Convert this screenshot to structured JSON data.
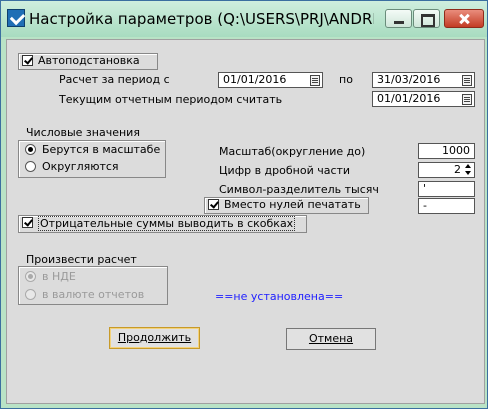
{
  "window": {
    "title": "Настройка параметров (Q:\\USERS\\PRJ\\ANDREYV..."
  },
  "auto": {
    "label": "Автоподстановка",
    "checked": true,
    "period_label": "Расчет за период с",
    "date_from": "01/01/2016",
    "to_label": "по",
    "date_to": "31/03/2016",
    "current_period_label": "Текущим отчетным периодом считать",
    "current_period_date": "01/01/2016"
  },
  "numeric": {
    "group_label": "Числовые значения",
    "option_scale": "Берутся в масштабе",
    "option_round": "Округляются",
    "scale_label": "Масштаб(округление до)",
    "scale_value": "1000",
    "decimals_label": "Цифр в дробной части",
    "decimals_value": "2",
    "separator_label": "Символ-разделитель тысяч",
    "separator_value": "'",
    "zeros_label": "Вместо нулей печатать",
    "zeros_value": "-",
    "negative_label": "Отрицательные суммы выводить в скобках"
  },
  "calc": {
    "group_label": "Произвести расчет",
    "option_nde": "в НДЕ",
    "option_report_currency": "в валюте отчетов",
    "status": "==не установлена=="
  },
  "buttons": {
    "continue": "Продолжить",
    "cancel": "Отмена"
  }
}
